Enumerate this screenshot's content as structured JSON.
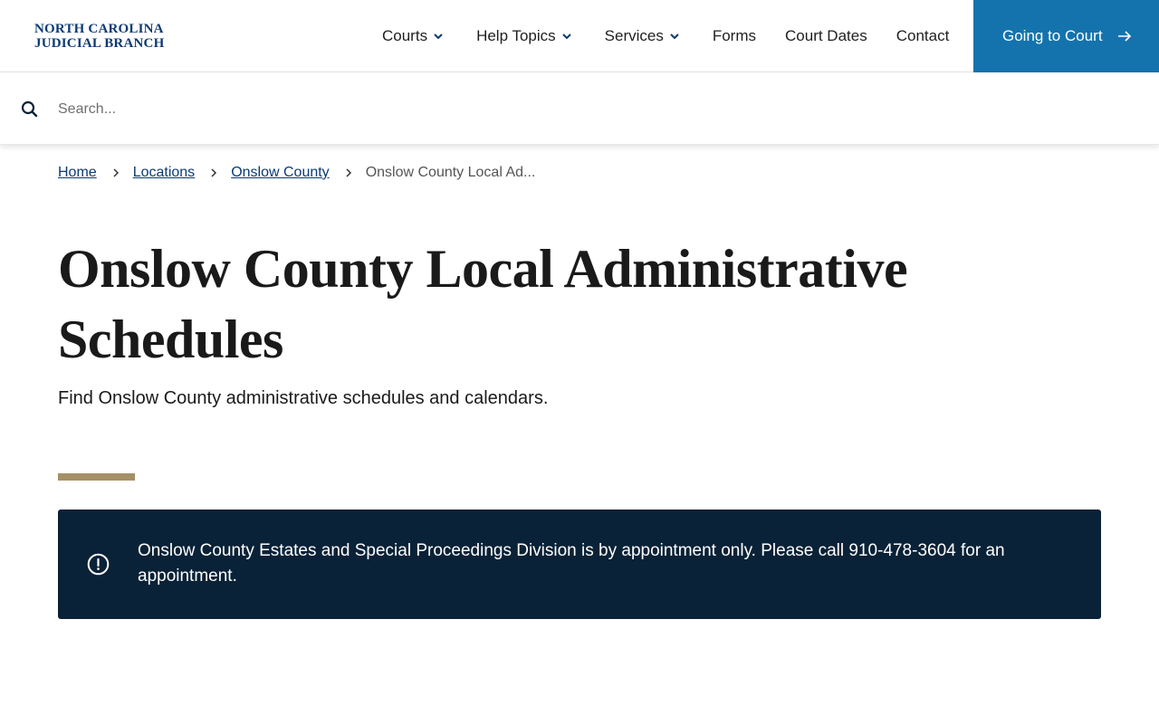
{
  "logo": {
    "line1": "NORTH CAROLINA",
    "line2": "JUDICIAL BRANCH"
  },
  "nav": {
    "courts": "Courts",
    "help_topics": "Help Topics",
    "services": "Services",
    "forms": "Forms",
    "court_dates": "Court Dates",
    "contact": "Contact",
    "cta": "Going to Court"
  },
  "search": {
    "placeholder": "Search..."
  },
  "breadcrumb": {
    "home": "Home",
    "locations": "Locations",
    "county": "Onslow County",
    "current": "Onslow County Local Ad..."
  },
  "page": {
    "title": "Onslow County Local Administrative Schedules",
    "subtitle": "Find Onslow County administrative schedules and calendars."
  },
  "alert": {
    "icon": "alert-circle-icon",
    "text": "Onslow County Estates and Special Proceedings Division is by appointment only. Please call 910-478-3604 for an appointment."
  },
  "colors": {
    "brand_blue": "#0b3a74",
    "cta_blue": "#1473ad",
    "alert_bg": "#0a2237",
    "accent_gold": "#a59066"
  }
}
